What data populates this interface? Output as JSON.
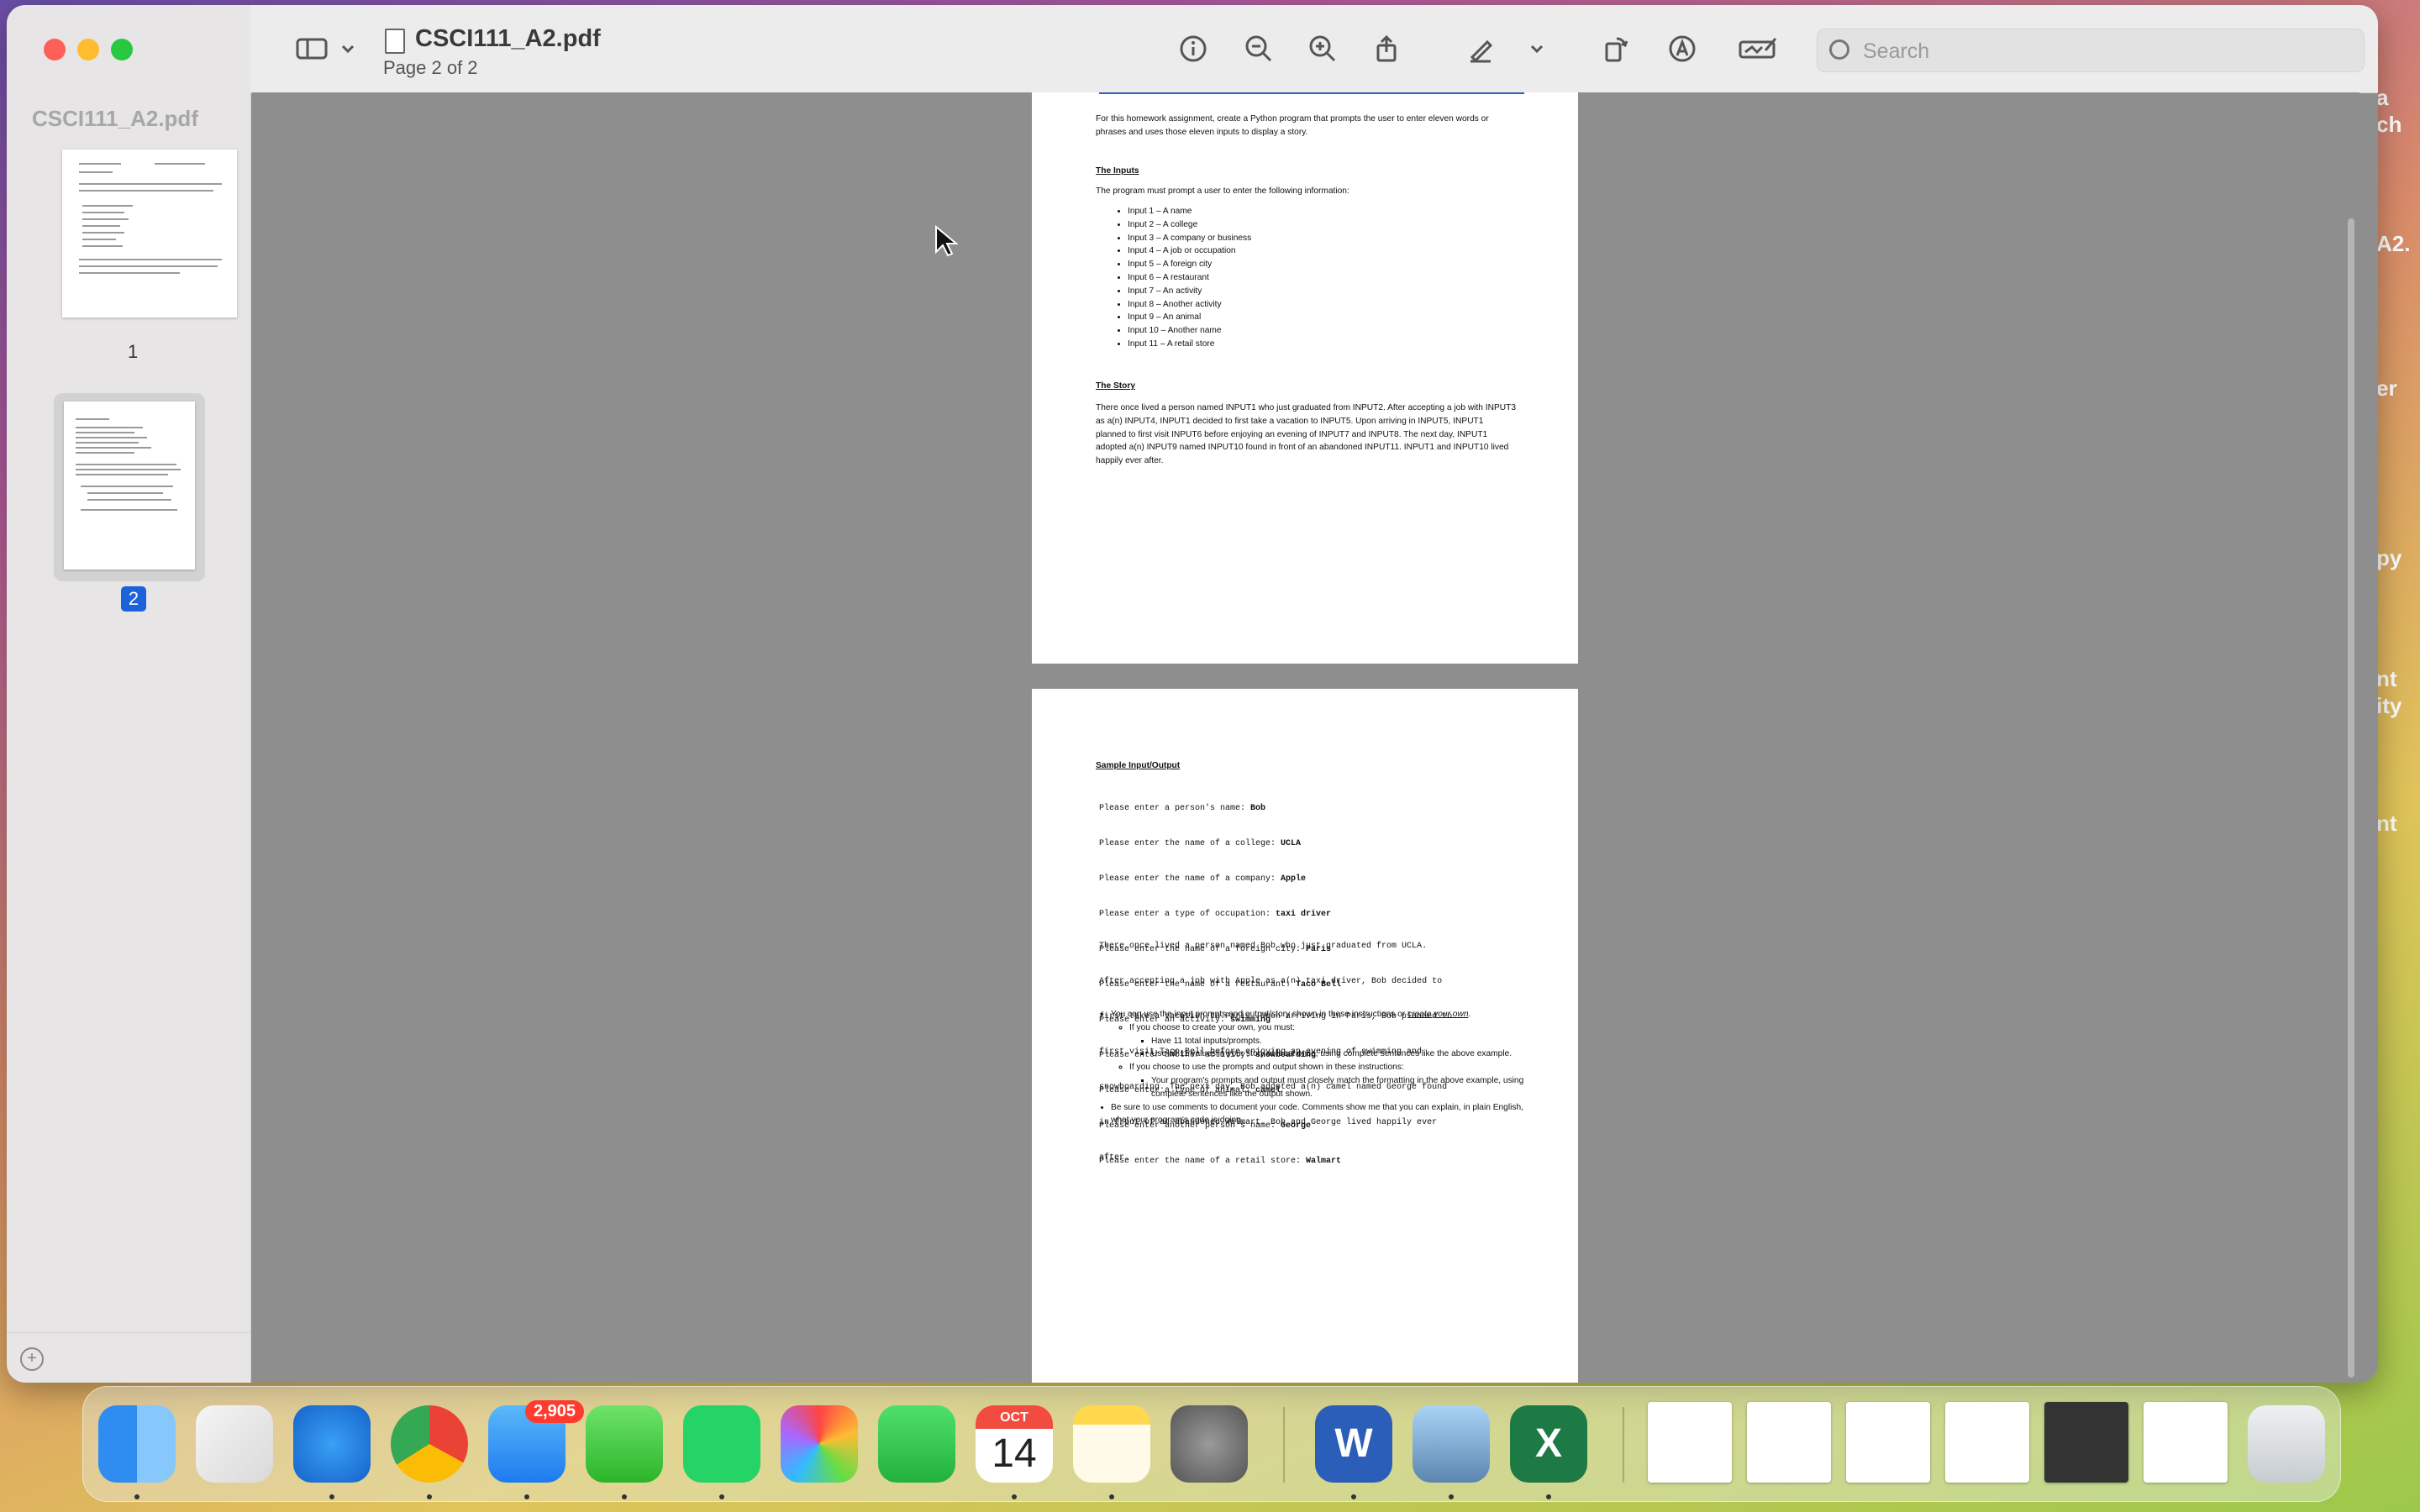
{
  "window": {
    "doc_title": "CSCI111_A2.pdf",
    "page_indicator": "Page 2 of 2"
  },
  "sidebar": {
    "title": "CSCI111_A2.pdf",
    "pages": [
      {
        "label": "1"
      },
      {
        "label": "2"
      }
    ]
  },
  "toolbar": {
    "search_placeholder": "Search",
    "icons": [
      "sidebar-icon",
      "chevron-down-icon",
      "info-icon",
      "zoom-out-icon",
      "zoom-in-icon",
      "share-icon",
      "markup-pen-icon",
      "chevron-down-icon",
      "rotate-icon",
      "annotate-icon",
      "signature-icon",
      "search-icon"
    ]
  },
  "page_a": {
    "intro": "For this homework assignment, create a Python program that prompts the user to enter eleven words or phrases and uses those eleven inputs to display a story.",
    "inputs_heading": "The Inputs",
    "inputs_lead": "The program must prompt a user to enter the following information:",
    "inputs": [
      "Input 1 – A name",
      "Input 2 – A college",
      "Input 3 – A company or business",
      "Input 4 – A job or occupation",
      "Input 5 – A foreign city",
      "Input 6 – A restaurant",
      "Input 7 – An activity",
      "Input 8 – Another activity",
      "Input 9 – An animal",
      "Input 10 – Another name",
      "Input 11 – A retail store"
    ],
    "story_heading": "The Story",
    "story": "There once lived a person named INPUT1 who just graduated from INPUT2. After accepting a job with INPUT3 as a(n) INPUT4, INPUT1 decided to first take a vacation to INPUT5. Upon arriving in INPUT5, INPUT1 planned to first visit INPUT6 before enjoying an evening of INPUT7 and INPUT8. The next day, INPUT1 adopted a(n) INPUT9 named INPUT10 found in front of an abandoned INPUT11. INPUT1 and INPUT10 lived happily ever after."
  },
  "page_b": {
    "heading": "Sample Input/Output",
    "prompts": [
      {
        "q": "Please enter a person's name: ",
        "a": "Bob"
      },
      {
        "q": "Please enter the name of a college: ",
        "a": "UCLA"
      },
      {
        "q": "Please enter the name of a company: ",
        "a": "Apple"
      },
      {
        "q": "Please enter a type of occupation: ",
        "a": "taxi driver"
      },
      {
        "q": "Please enter the name of a foreign city: ",
        "a": "Paris"
      },
      {
        "q": "Please enter the name of a restaurant: ",
        "a": "Taco Bell"
      },
      {
        "q": "Please enter an activity: ",
        "a": "swimming"
      },
      {
        "q": "Please enter another activity: ",
        "a": "snowboarding"
      },
      {
        "q": "Please enter a type of animal: ",
        "a": "camel"
      },
      {
        "q": "Please enter another person's name: ",
        "a": "George"
      },
      {
        "q": "Please enter the name of a retail store: ",
        "a": "Walmart"
      }
    ],
    "output_lines": [
      "There once lived a person named Bob who just graduated from UCLA.",
      "After accepting a job with Apple as a(n) taxi driver, Bob decided to",
      "first take a vacation to Paris. Upon arriving in Paris, Bob planned to",
      "first visit Taco Bell before enjoying an evening of swimming and",
      "snowboarding. The next day, Bob adopted a(n) camel named George found",
      "in front of an abandoned Walmart. Bob and George lived happily ever",
      "after."
    ],
    "bullet1_a": "You can use the input prompts and output/story shown in these instructions or ",
    "bullet1_b": "create your own",
    "bullet1_c": ".",
    "sub1": "If you choose to create your own, you must:",
    "sub1_items": [
      "Have 11 total inputs/prompts.",
      "Use all 11 values in your story at least once, using complete sentences like the above example."
    ],
    "sub2": "If you choose to use the prompts and output shown in these instructions:",
    "sub2_items": [
      "Your program's prompts and output must closely match the formatting in the above example, using complete sentences like the output shown."
    ],
    "bullet2": "Be sure to use comments to document your code. Comments show me that you can explain, in plain English, what your program's code is doing."
  },
  "desktop_text": [
    "a",
    "ch",
    "A2.",
    "er",
    "py",
    "nt",
    "ity",
    "nt"
  ],
  "dock": {
    "apps": [
      "Finder",
      "Launchpad",
      "Safari",
      "Chrome",
      "Mail",
      "Messages",
      "WhatsApp",
      "Photos",
      "FaceTime",
      "Calendar",
      "Notes",
      "System Settings",
      "Word",
      "Preview",
      "Excel"
    ],
    "mail_badge": "2,905",
    "calendar_month": "OCT",
    "calendar_day": "14"
  }
}
